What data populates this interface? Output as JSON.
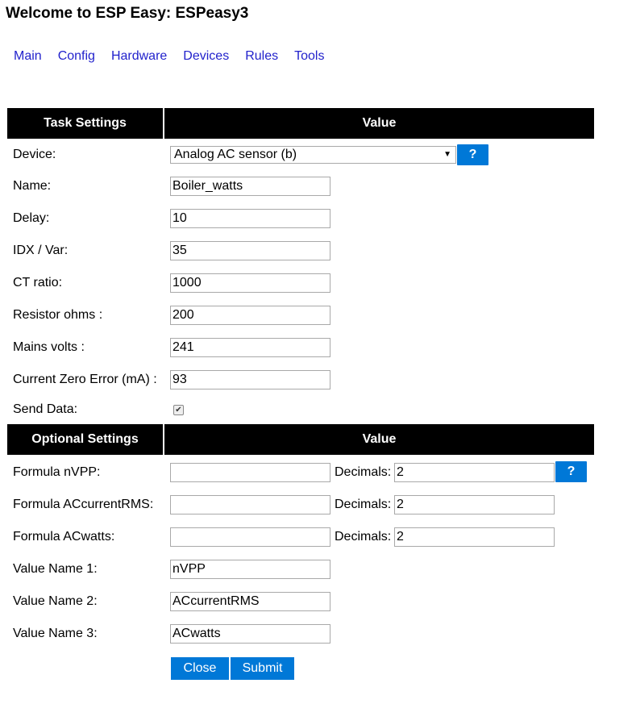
{
  "page": {
    "title": "Welcome to ESP Easy: ESPeasy3"
  },
  "nav": [
    "Main",
    "Config",
    "Hardware",
    "Devices",
    "Rules",
    "Tools"
  ],
  "task_table": {
    "col1": "Task Settings",
    "col2": "Value",
    "device_label": "Device:",
    "device_value": "Analog AC sensor (b)",
    "help_label": "?",
    "fields": [
      {
        "label": "Name:",
        "value": "Boiler_watts"
      },
      {
        "label": "Delay:",
        "value": "10"
      },
      {
        "label": "IDX / Var:",
        "value": "35"
      },
      {
        "label": "CT ratio:",
        "value": "1000"
      },
      {
        "label": "Resistor ohms :",
        "value": "200"
      },
      {
        "label": "Mains volts :",
        "value": "241"
      },
      {
        "label": "Current Zero Error (mA) :",
        "value": "93"
      }
    ],
    "send_data_label": "Send Data:",
    "send_data_checked": "✔"
  },
  "optional_table": {
    "col1": "Optional Settings",
    "col2": "Value",
    "decimals_label": "Decimals:",
    "help_label": "?",
    "formulas": [
      {
        "label": "Formula nVPP:",
        "value": "",
        "decimals": "2"
      },
      {
        "label": "Formula ACcurrentRMS:",
        "value": "",
        "decimals": "2"
      },
      {
        "label": "Formula ACwatts:",
        "value": "",
        "decimals": "2"
      }
    ],
    "value_names": [
      {
        "label": "Value Name 1:",
        "value": "nVPP"
      },
      {
        "label": "Value Name 2:",
        "value": "ACcurrentRMS"
      },
      {
        "label": "Value Name 3:",
        "value": "ACwatts"
      }
    ]
  },
  "buttons": {
    "close": "Close",
    "submit": "Submit"
  }
}
